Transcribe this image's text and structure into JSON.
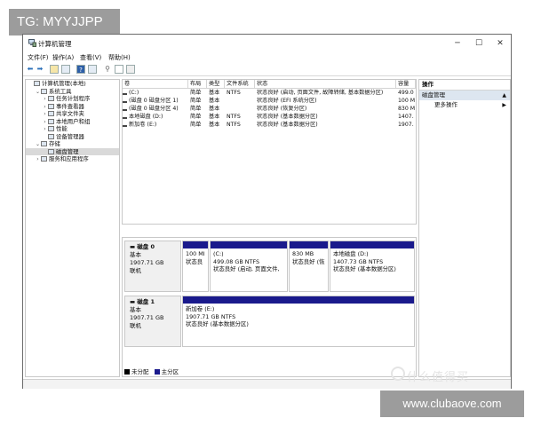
{
  "overlay": {
    "tg_label": "TG: MYYJJPP",
    "watermark": "什么值得买",
    "url": "www.clubaove.com"
  },
  "window": {
    "title": "计算机管理",
    "min_icon": "─",
    "max_icon": "☐",
    "close_icon": "✕"
  },
  "menu": [
    "文件(F)",
    "操作(A)",
    "查看(V)",
    "帮助(H)"
  ],
  "tree": [
    {
      "label": "计算机管理(本地)",
      "arrow": "",
      "level": 0
    },
    {
      "label": "系统工具",
      "arrow": "⌄",
      "level": 1
    },
    {
      "label": "任务计划程序",
      "arrow": "›",
      "level": 2
    },
    {
      "label": "事件查看器",
      "arrow": "›",
      "level": 2
    },
    {
      "label": "共享文件夹",
      "arrow": "›",
      "level": 2
    },
    {
      "label": "本地用户和组",
      "arrow": "›",
      "level": 2
    },
    {
      "label": "性能",
      "arrow": "›",
      "level": 2
    },
    {
      "label": "设备管理器",
      "arrow": "",
      "level": 2
    },
    {
      "label": "存储",
      "arrow": "⌄",
      "level": 1
    },
    {
      "label": "磁盘管理",
      "arrow": "",
      "level": 2,
      "selected": true
    },
    {
      "label": "服务和应用程序",
      "arrow": "›",
      "level": 1
    }
  ],
  "volumes": {
    "headers": [
      "卷",
      "布局",
      "类型",
      "文件系统",
      "状态",
      "容量"
    ],
    "rows": [
      [
        "(C:)",
        "简单",
        "基本",
        "NTFS",
        "状态良好 (启动, 页面文件, 故障转储, 基本数据分区)",
        "499.0"
      ],
      [
        "(磁盘 0 磁盘分区 1)",
        "简单",
        "基本",
        "",
        "状态良好 (EFI 系统分区)",
        "100 M"
      ],
      [
        "(磁盘 0 磁盘分区 4)",
        "简单",
        "基本",
        "",
        "状态良好 (恢复分区)",
        "830 M"
      ],
      [
        "本地磁盘 (D:)",
        "简单",
        "基本",
        "NTFS",
        "状态良好 (基本数据分区)",
        "1407."
      ],
      [
        "新加卷 (E:)",
        "简单",
        "基本",
        "NTFS",
        "状态良好 (基本数据分区)",
        "1907."
      ]
    ]
  },
  "disks": [
    {
      "name": "磁盘 0",
      "type": "基本",
      "size": "1907.71 GB",
      "status": "联机",
      "parts": [
        {
          "title": "",
          "size": "100 MI",
          "status": "状态良"
        },
        {
          "title": "(C:)",
          "size": "499.08 GB NTFS",
          "status": "状态良好 (启动, 页面文件,"
        },
        {
          "title": "",
          "size": "830 MB",
          "status": "状态良好 (恢"
        },
        {
          "title": "本地磁盘 (D:)",
          "size": "1407.73 GB NTFS",
          "status": "状态良好 (基本数据分区)"
        }
      ]
    },
    {
      "name": "磁盘 1",
      "type": "基本",
      "size": "1907.71 GB",
      "status": "联机",
      "parts": [
        {
          "title": "新加卷 (E:)",
          "size": "1907.71 GB NTFS",
          "status": "状态良好 (基本数据分区)"
        }
      ]
    }
  ],
  "legend": {
    "unallocated": "未分配",
    "primary": "主分区"
  },
  "actions": {
    "header": "操作",
    "section": "磁盘管理",
    "more": "更多操作"
  },
  "colors": {
    "primary_partition": "#1a1a8c",
    "unallocated": "#000000",
    "selection": "#d9d9d9"
  }
}
